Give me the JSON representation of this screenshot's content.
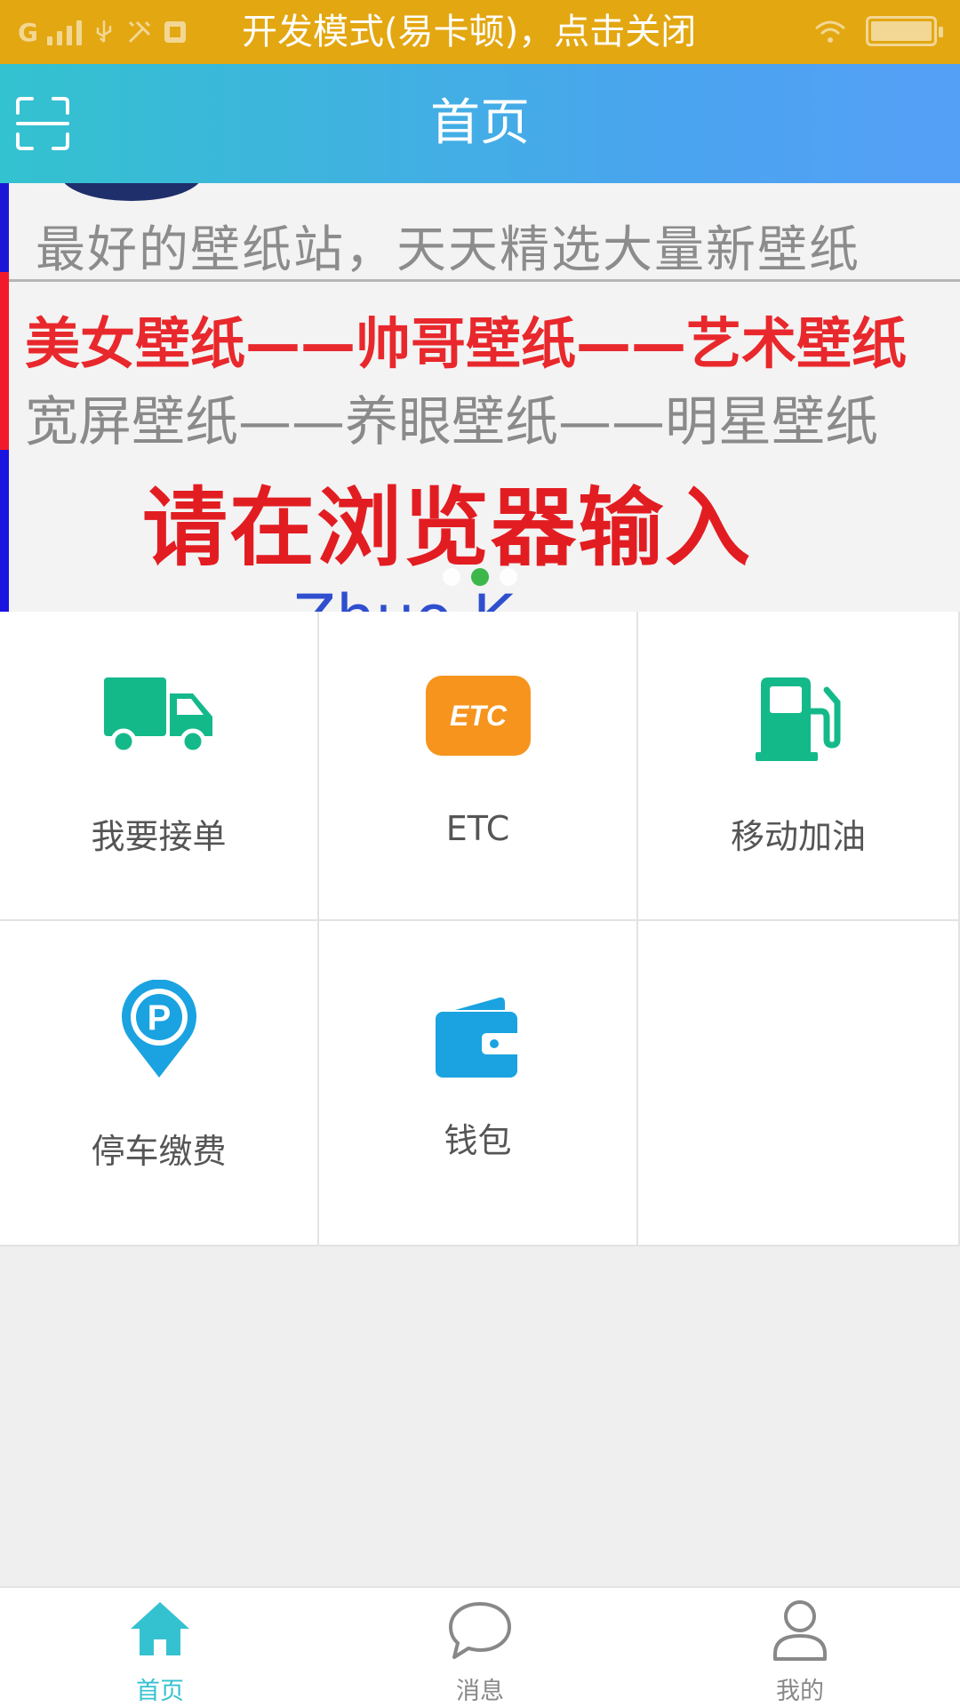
{
  "status_bar": {
    "network": "G",
    "notification_text": "开发模式(易卡顿)，点击关闭"
  },
  "header": {
    "title": "首页",
    "scan_icon": "scan-icon",
    "gradient_colors": [
      "#33c2cf",
      "#55a0f7"
    ]
  },
  "banner": {
    "line1": "最好的壁纸站，天天精选大量新壁纸",
    "line2": "美女壁纸——帅哥壁纸——艺术壁纸",
    "line3": "宽屏壁纸——养眼壁纸——明星壁纸",
    "line4": "请在浏览器输入",
    "line5": "Zhuo K",
    "page_count": 3,
    "active_page": 2,
    "active_dot_color": "#3cb84a"
  },
  "menu": {
    "items": [
      {
        "label": "我要接单",
        "icon": "truck-icon",
        "color": "#14b98a"
      },
      {
        "label": "ETC",
        "icon": "etc-icon",
        "color": "#f7941d"
      },
      {
        "label": "移动加油",
        "icon": "fuel-pump-icon",
        "color": "#14b98a"
      },
      {
        "label": "停车缴费",
        "icon": "parking-pin-icon",
        "color": "#1aa3e0"
      },
      {
        "label": "钱包",
        "icon": "wallet-icon",
        "color": "#1aa3e0"
      }
    ]
  },
  "bottom_nav": {
    "items": [
      {
        "label": "首页",
        "icon": "home-icon",
        "active": true
      },
      {
        "label": "消息",
        "icon": "chat-bubble-icon",
        "active": false
      },
      {
        "label": "我的",
        "icon": "user-icon",
        "active": false
      }
    ],
    "active_color": "#35c2d0"
  }
}
